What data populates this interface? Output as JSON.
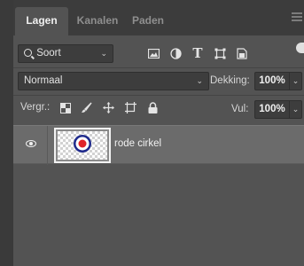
{
  "tabs": [
    {
      "label": "Lagen",
      "active": true
    },
    {
      "label": "Kanalen",
      "active": false
    },
    {
      "label": "Paden",
      "active": false
    }
  ],
  "filter": {
    "kind_label": "Soort",
    "icons": [
      "image-filter-icon",
      "adjustment-filter-icon",
      "type-filter-icon",
      "shape-filter-icon",
      "smart-object-filter-icon"
    ]
  },
  "blend": {
    "mode": "Normaal",
    "opacity_label": "Dekking:",
    "opacity_value": "100%"
  },
  "lock": {
    "label": "Vergr.:",
    "icons": [
      "lock-transparent-pixels-icon",
      "lock-image-pixels-icon",
      "lock-position-icon",
      "lock-artboard-icon",
      "lock-all-icon"
    ],
    "fill_label": "Vul:",
    "fill_value": "100%"
  },
  "layers": [
    {
      "name": "rode cirkel",
      "visible": true,
      "thumbnail": "target-circle"
    }
  ],
  "colors": {
    "panel_bg": "#535353",
    "selected_layer_bg": "#6b6b6b",
    "circle_red": "#e0242a",
    "circle_blue": "#1f2a8c"
  }
}
